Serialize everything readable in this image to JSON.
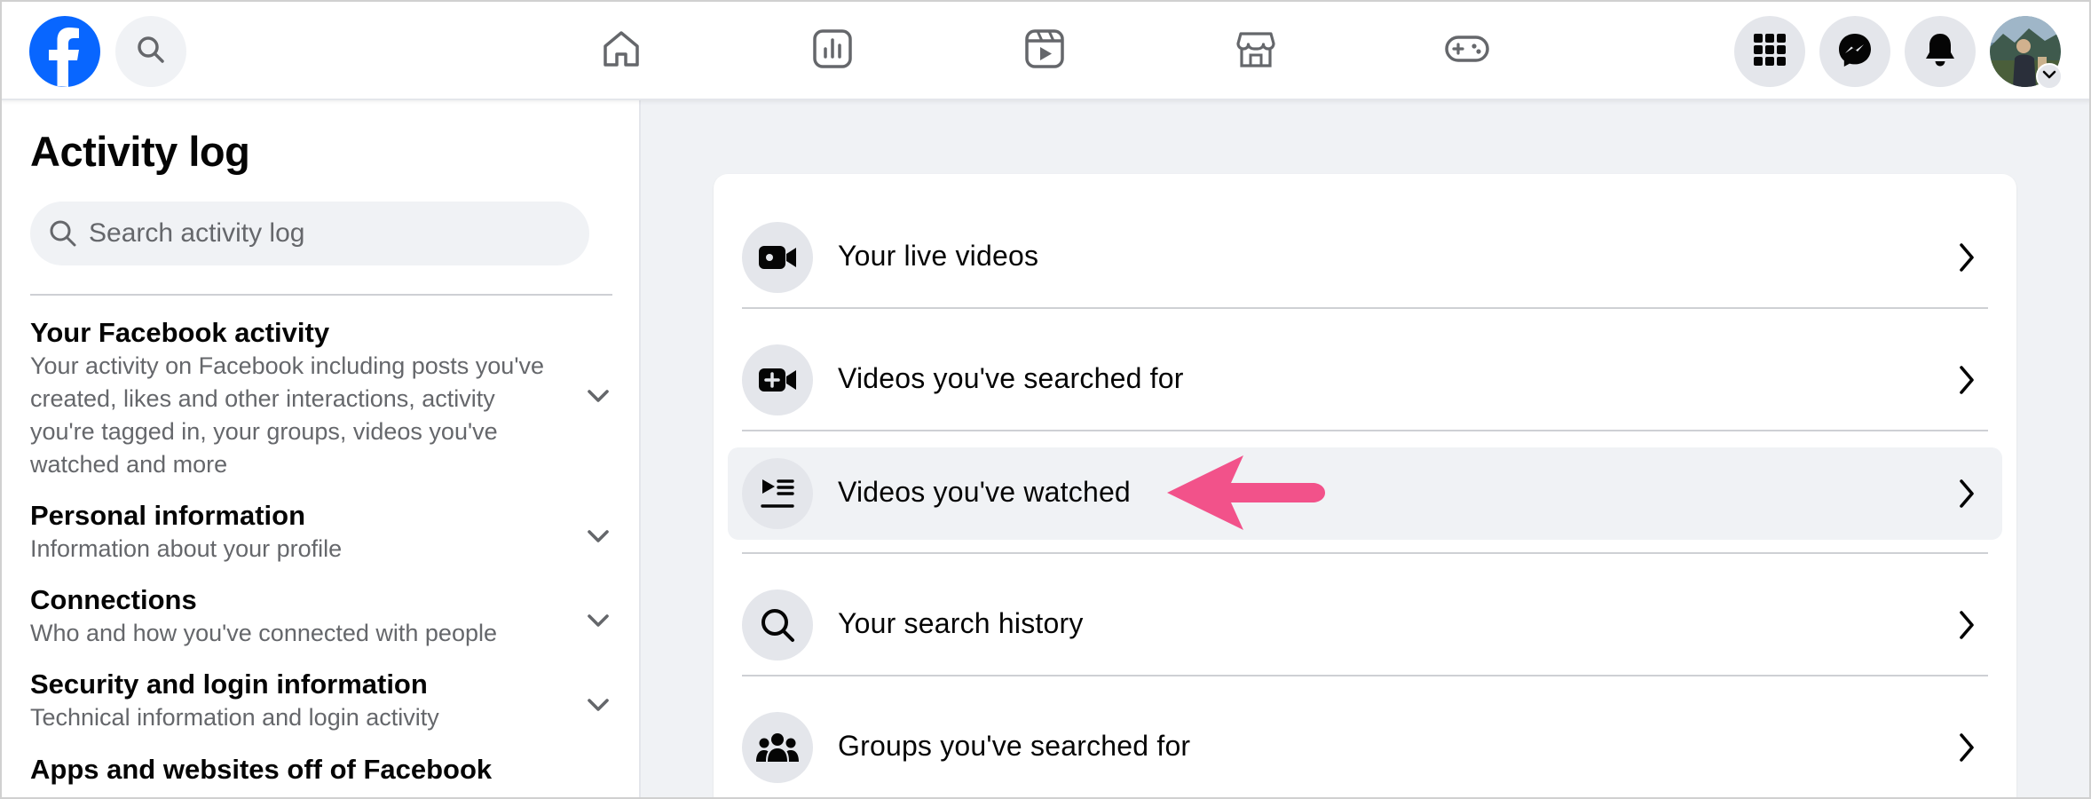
{
  "topbar": {
    "logo_icon": "facebook-logo-icon",
    "search_icon": "search-icon",
    "nav": [
      {
        "icon": "home-icon"
      },
      {
        "icon": "feeds-chart-icon"
      },
      {
        "icon": "video-icon"
      },
      {
        "icon": "marketplace-store-icon"
      },
      {
        "icon": "gaming-controller-icon"
      }
    ],
    "right_buttons": [
      {
        "icon": "menu-grid-icon"
      },
      {
        "icon": "messenger-icon"
      },
      {
        "icon": "notifications-bell-icon"
      }
    ],
    "avatar_icon": "profile-avatar"
  },
  "sidebar": {
    "title": "Activity log",
    "search_placeholder": "Search activity log",
    "sections": [
      {
        "title": "Your Facebook activity",
        "description": "Your activity on Facebook including posts you've created, likes and other interactions, activity you're tagged in, your groups, videos you've watched and more"
      },
      {
        "title": "Personal information",
        "description": "Information about your profile"
      },
      {
        "title": "Connections",
        "description": "Who and how you've connected with people"
      },
      {
        "title": "Security and login information",
        "description": "Technical information and login activity"
      },
      {
        "title": "Apps and websites off of Facebook",
        "description": ""
      }
    ]
  },
  "main": {
    "items": [
      {
        "label": "Your live videos",
        "icon": "live-video-camera-icon"
      },
      {
        "label": "Videos you've searched for",
        "icon": "video-search-plus-icon"
      },
      {
        "label": "Videos you've watched",
        "icon": "watched-videos-list-icon",
        "active": true
      },
      {
        "label": "Your search history",
        "icon": "search-icon"
      },
      {
        "label": "Groups you've searched for",
        "icon": "groups-icon"
      }
    ]
  },
  "annotation": {
    "color": "#f2528a"
  },
  "colors": {
    "brand_blue": "#0866ff",
    "page_bg": "#f0f2f5",
    "icon_circle": "#e4e6eb"
  }
}
